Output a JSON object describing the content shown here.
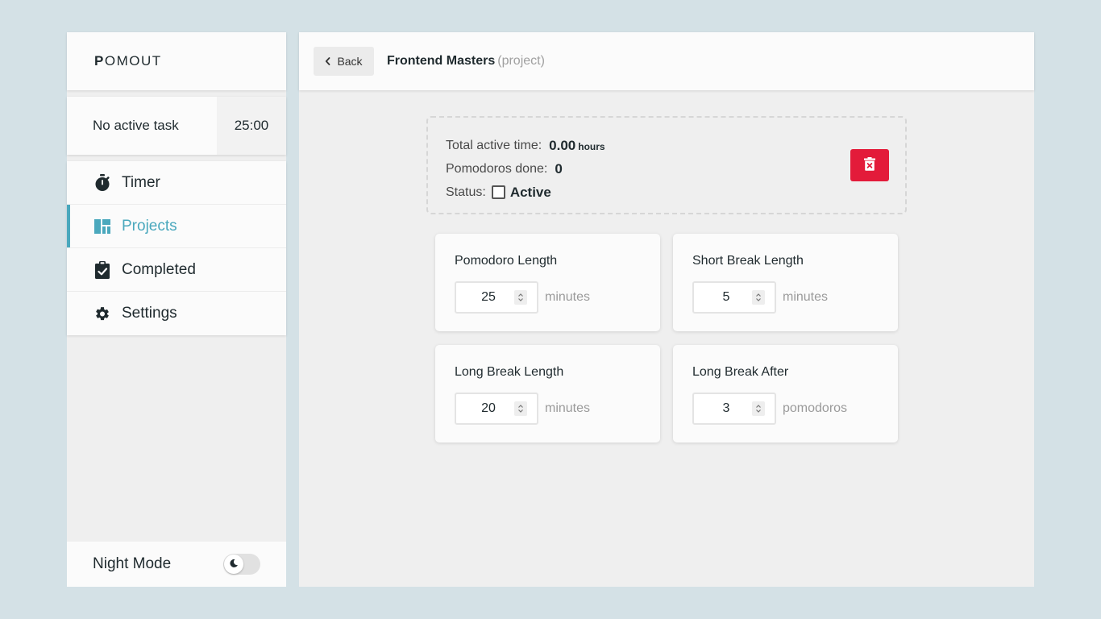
{
  "app": {
    "logo_first": "P",
    "logo_rest": "OMOUT"
  },
  "active_task": {
    "label": "No active task",
    "time": "25:00"
  },
  "nav": [
    {
      "label": "Timer",
      "icon": "stopwatch-icon"
    },
    {
      "label": "Projects",
      "icon": "dashboard-icon",
      "active": true
    },
    {
      "label": "Completed",
      "icon": "clipboard-check-icon"
    },
    {
      "label": "Settings",
      "icon": "gear-icon"
    }
  ],
  "night_mode": {
    "label": "Night Mode",
    "enabled": false,
    "icon": "moon-icon"
  },
  "header": {
    "back_label": "Back",
    "title": "Frontend Masters",
    "subtitle": "(project)"
  },
  "summary": {
    "total_label": "Total active time:",
    "total_value": "0.00",
    "total_unit": "hours",
    "pomodoros_label": "Pomodoros done:",
    "pomodoros_value": "0",
    "status_label": "Status:",
    "status_value": "Active",
    "status_checked": false,
    "delete_icon": "trash-icon"
  },
  "settings": [
    {
      "title": "Pomodoro Length",
      "value": "25",
      "unit": "minutes"
    },
    {
      "title": "Short Break Length",
      "value": "5",
      "unit": "minutes"
    },
    {
      "title": "Long Break Length",
      "value": "20",
      "unit": "minutes"
    },
    {
      "title": "Long Break After",
      "value": "3",
      "unit": "pomodoros"
    }
  ],
  "colors": {
    "accent": "#4aa8bd",
    "danger": "#e31b3a",
    "background": "#d4e1e6"
  }
}
